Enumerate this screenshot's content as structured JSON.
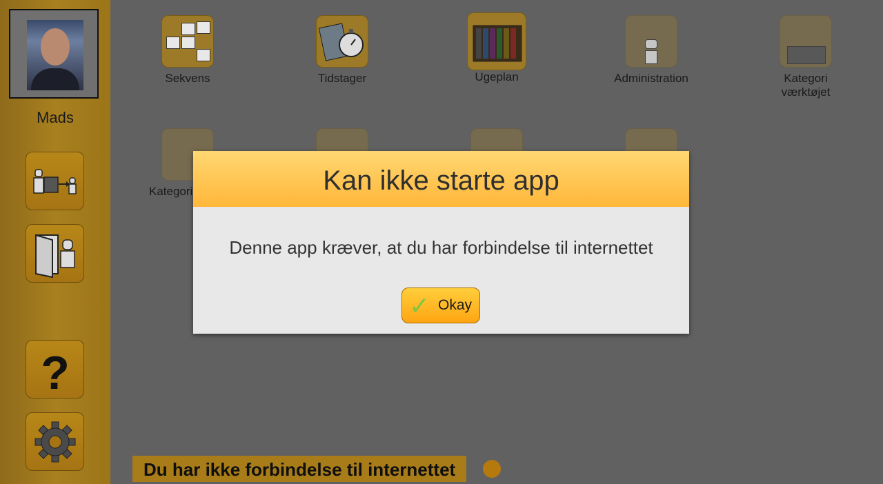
{
  "sidebar": {
    "profile_name": "Mads",
    "buttons": [
      {
        "name": "transfer-tablet-button",
        "icon": "person-tablet-person-icon"
      },
      {
        "name": "logout-door-button",
        "icon": "door-person-icon"
      },
      {
        "name": "help-button",
        "icon": "question-mark-icon"
      },
      {
        "name": "settings-button",
        "icon": "gear-icon"
      }
    ]
  },
  "apps": [
    {
      "label": "Sekvens",
      "icon": "sequence-icon"
    },
    {
      "label": "Tidstager",
      "icon": "stopwatch-icon"
    },
    {
      "label": "Ugeplan",
      "icon": "weekplan-icon"
    },
    {
      "label": "Administration",
      "icon": "administration-icon"
    },
    {
      "label": "Kategori værktøjet",
      "icon": "category-tool-icon"
    },
    {
      "label": "Kategori",
      "icon": "category-icon"
    },
    {
      "label": "",
      "icon": "sequence-2-icon"
    },
    {
      "label": "",
      "icon": "camera-icon"
    },
    {
      "label": "",
      "icon": "bus-icon"
    }
  ],
  "status": {
    "text": "Du har ikke forbindelse til internettet"
  },
  "dialog": {
    "title": "Kan ikke starte app",
    "message": "Denne app kræver, at du har forbindelse til internettet",
    "ok_label": "Okay"
  },
  "colors": {
    "accent": "#ffb73a",
    "overlay": "#616161",
    "check": "#7ec63f"
  }
}
